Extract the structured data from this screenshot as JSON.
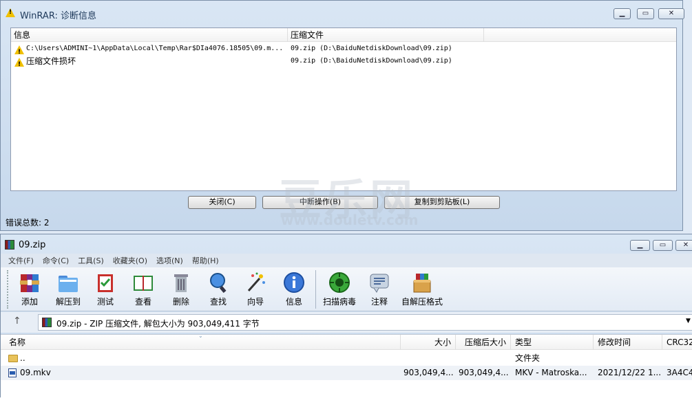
{
  "diag": {
    "title": "WinRAR: 诊断信息",
    "columns": [
      "信息",
      "压缩文件"
    ],
    "rows": [
      {
        "info": "C:\\Users\\ADMINI~1\\AppData\\Local\\Temp\\Rar$DIa4076.18505\\09.m...",
        "archive": "09.zip (D:\\BaiduNetdiskDownload\\09.zip)"
      },
      {
        "info": "压缩文件损坏",
        "archive": "09.zip (D:\\BaiduNetdiskDownload\\09.zip)"
      }
    ],
    "buttons": {
      "close": "关闭(C)",
      "abort": "中断操作(B)",
      "copy": "复制到剪贴板(L)"
    },
    "error_total": "错误总数: 2"
  },
  "main": {
    "title": "09.zip",
    "menu": [
      "文件(F)",
      "命令(C)",
      "工具(S)",
      "收藏夹(O)",
      "选项(N)",
      "帮助(H)"
    ],
    "toolbar": [
      "添加",
      "解压到",
      "测试",
      "查看",
      "删除",
      "查找",
      "向导",
      "信息",
      "扫描病毒",
      "注释",
      "自解压格式"
    ],
    "address": "09.zip - ZIP 压缩文件, 解包大小为 903,049,411 字节",
    "columns": [
      "名称",
      "大小",
      "压缩后大小",
      "类型",
      "修改时间",
      "CRC32"
    ],
    "files": [
      {
        "name": "..",
        "size": "",
        "packed": "",
        "type": "文件夹",
        "modified": "",
        "crc": ""
      },
      {
        "name": "09.mkv",
        "size": "903,049,4...",
        "packed": "903,049,4...",
        "type": "MKV - Matroska...",
        "modified": "2021/12/22 1...",
        "crc": "3A4C4"
      }
    ]
  },
  "watermark": {
    "big": "豆乐网",
    "url": "www.douletv.com"
  }
}
